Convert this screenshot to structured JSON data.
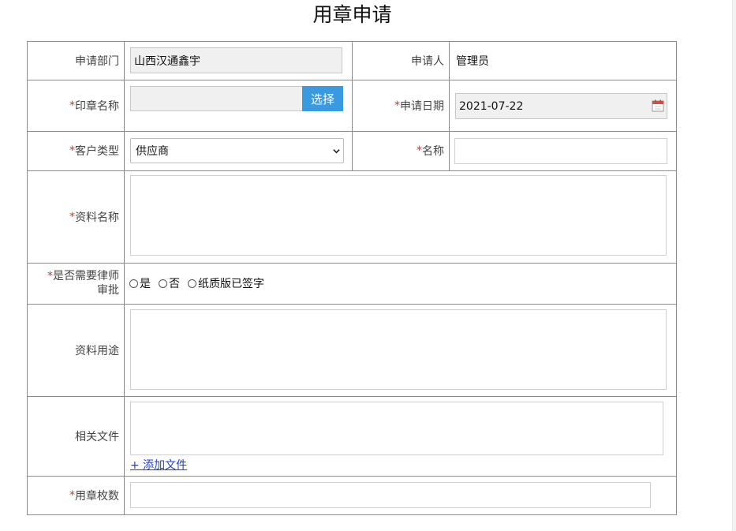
{
  "page": {
    "title": "用章申请"
  },
  "form": {
    "department": {
      "label": "申请部门",
      "value": "山西汉通鑫宇"
    },
    "applicant": {
      "label": "申请人",
      "value": "管理员"
    },
    "seal_name": {
      "label": "印章名称",
      "value": "",
      "button": "选择"
    },
    "apply_date": {
      "label": "申请日期",
      "value": "2021-07-22"
    },
    "customer_type": {
      "label": "客户类型",
      "selected": "供应商"
    },
    "name": {
      "label": "名称",
      "value": ""
    },
    "material_name": {
      "label": "资料名称",
      "value": ""
    },
    "lawyer_review": {
      "label_line1": "是否需要律师",
      "label_line2": "审批",
      "options": [
        "是",
        "否",
        "纸质版已签字"
      ]
    },
    "material_use": {
      "label": "资料用途",
      "value": ""
    },
    "related_files": {
      "label": "相关文件",
      "add_link": "+ 添加文件"
    },
    "seal_count": {
      "label": "用章枚数",
      "value": ""
    }
  },
  "required_mark": "*",
  "colors": {
    "accent": "#3a9ae0",
    "required": "#e0302a",
    "link": "#1a3ed8",
    "border": "#8c8c8c",
    "readonly_bg": "#f0f0f0"
  },
  "icons": {
    "date_picker": "calendar-icon",
    "dropdown": "chevron-down-icon"
  }
}
